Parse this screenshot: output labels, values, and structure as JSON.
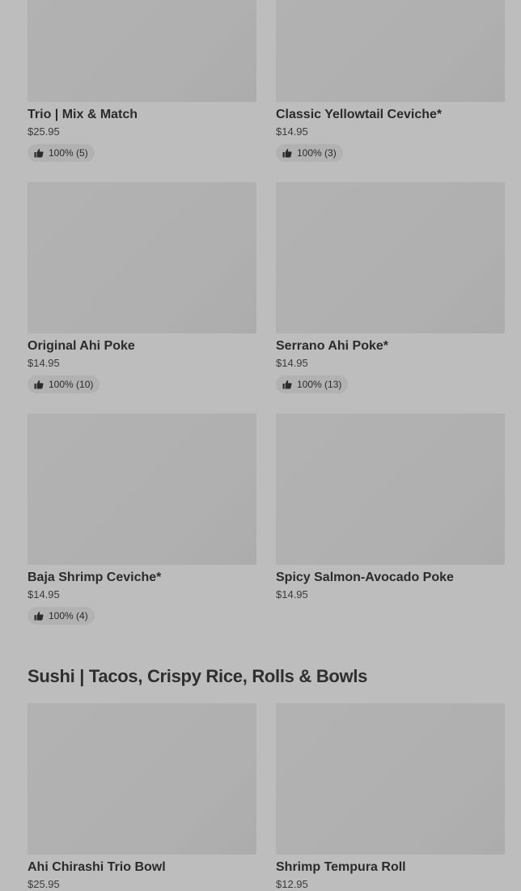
{
  "menu_items_top": [
    {
      "name": "Trio | Mix & Match",
      "price": "$25.95",
      "rating": "100% (5)"
    },
    {
      "name": "Classic Yellowtail Ceviche*",
      "price": "$14.95",
      "rating": "100% (3)"
    },
    {
      "name": "Original Ahi Poke",
      "price": "$14.95",
      "rating": "100% (10)"
    },
    {
      "name": "Serrano Ahi Poke*",
      "price": "$14.95",
      "rating": "100% (13)"
    },
    {
      "name": "Baja Shrimp Ceviche*",
      "price": "$14.95",
      "rating": "100% (4)"
    },
    {
      "name": "Spicy Salmon-Avocado Poke",
      "price": "$14.95"
    }
  ],
  "sushi_section": {
    "title": "Sushi | Tacos, Crispy Rice, Rolls & Bowls",
    "items": [
      {
        "name": "Ahi Chirashi Trio Bowl",
        "price": "$25.95"
      },
      {
        "name": "Shrimp Tempura Roll",
        "price": "$12.95"
      }
    ]
  },
  "icons": {
    "rating": "thumbs-up-icon"
  },
  "colors": {
    "overlay": "#bdbdbd",
    "thumb": "#b0b0b0",
    "badge": "#b2b2b2"
  }
}
